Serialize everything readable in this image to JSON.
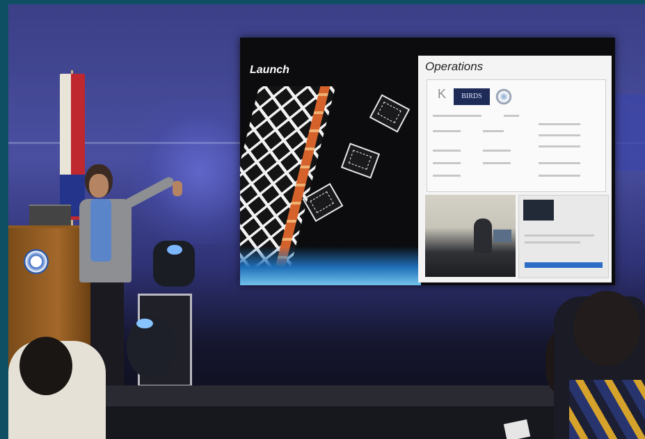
{
  "slide": {
    "left_title": "Launch",
    "right_title": "Operations",
    "logo_text": "BIRDS",
    "logo_k": "K"
  }
}
